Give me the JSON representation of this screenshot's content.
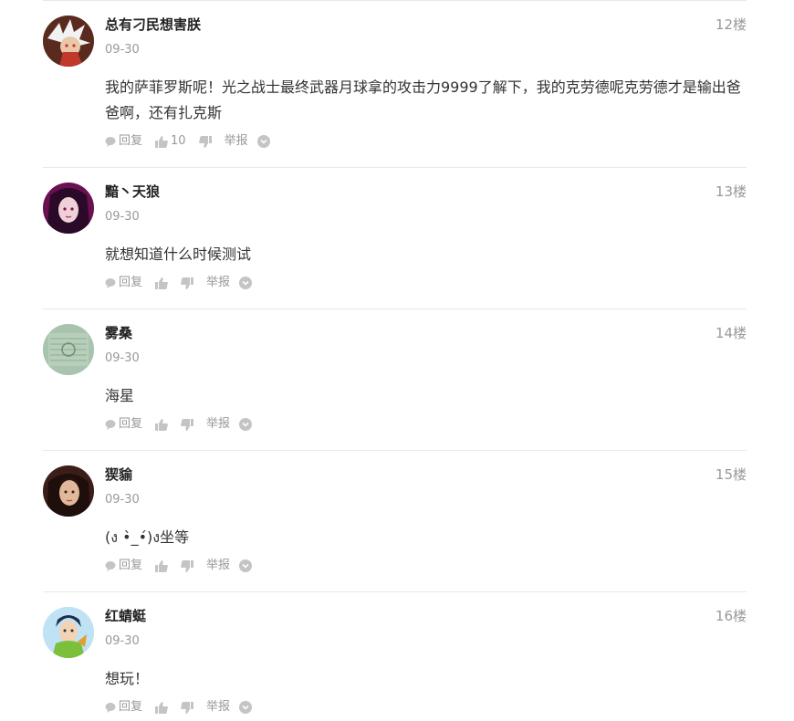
{
  "actions": {
    "reply_label": "回复",
    "report_label": "举报"
  },
  "comments": [
    {
      "username": "总有刁民想害朕",
      "floor": "12楼",
      "date": "09-30",
      "content": "我的萨菲罗斯呢！光之战士最终武器月球拿的攻击力9999了解下，我的克劳德呢克劳德才是输出爸爸啊，还有扎克斯",
      "likes": "10"
    },
    {
      "username": "黯丶天狼",
      "floor": "13楼",
      "date": "09-30",
      "content": "就想知道什么时候测试",
      "likes": ""
    },
    {
      "username": "雾桑",
      "floor": "14楼",
      "date": "09-30",
      "content": "海星",
      "likes": ""
    },
    {
      "username": "猰貐",
      "floor": "15楼",
      "date": "09-30",
      "content": "(ง •̀_•́)ง坐等",
      "likes": ""
    },
    {
      "username": "红蜻蜓",
      "floor": "16楼",
      "date": "09-30",
      "content": "想玩！",
      "likes": ""
    }
  ]
}
